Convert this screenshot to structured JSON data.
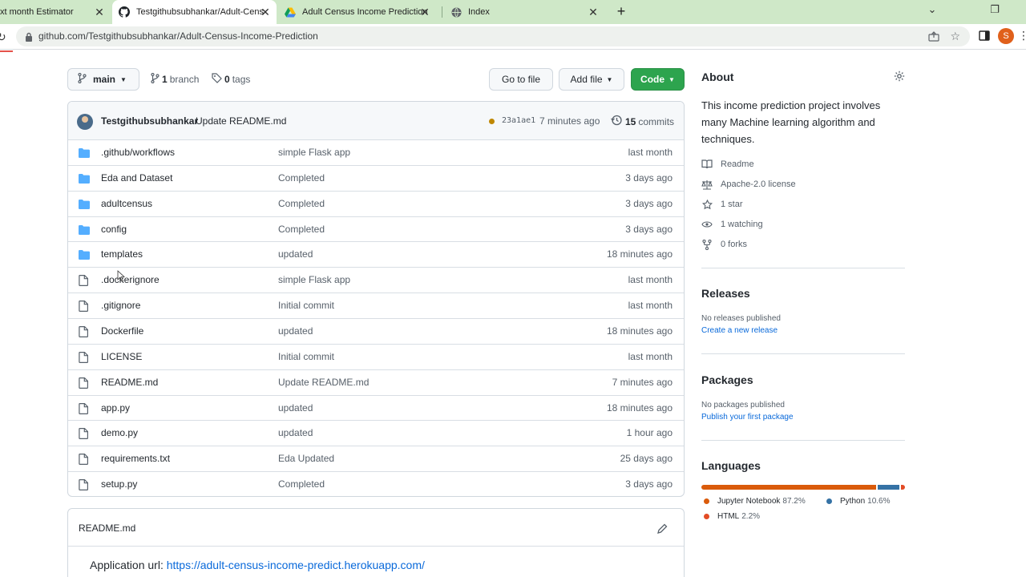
{
  "browser": {
    "tabs": [
      {
        "title": "xt month Estimator",
        "favicon": "none"
      },
      {
        "title": "Testgithubsubhankar/Adult-Cens",
        "favicon": "github-icon",
        "active": true
      },
      {
        "title": "Adult Census Income Prediction",
        "favicon": "google-drive-icon"
      },
      {
        "title": "Index",
        "favicon": "globe-icon"
      }
    ],
    "url": "github.com/Testgithubsubhankar/Adult-Census-Income-Prediction",
    "profile_initial": "S"
  },
  "repo": {
    "branch": "main",
    "branches_count": "1",
    "branches_label": "branch",
    "tags_count": "0",
    "tags_label": "tags",
    "go_to_file": "Go to file",
    "add_file": "Add file",
    "code": "Code"
  },
  "latest_commit": {
    "author": "Testgithubsubhankar",
    "message": "Update README.md",
    "sha": "23a1ae1",
    "time": "7 minutes ago",
    "commits_count": "15",
    "commits_label": "commits",
    "status_color": "#bf8700"
  },
  "files": [
    {
      "name": ".github/workflows",
      "type": "folder",
      "commit": "simple Flask app",
      "time": "last month"
    },
    {
      "name": "Eda and Dataset",
      "type": "folder",
      "commit": "Completed",
      "time": "3 days ago"
    },
    {
      "name": "adultcensus",
      "type": "folder",
      "commit": "Completed",
      "time": "3 days ago"
    },
    {
      "name": "config",
      "type": "folder",
      "commit": "Completed",
      "time": "3 days ago"
    },
    {
      "name": "templates",
      "type": "folder",
      "commit": "updated",
      "time": "18 minutes ago"
    },
    {
      "name": ".dockerignore",
      "type": "file",
      "commit": "simple Flask app",
      "time": "last month"
    },
    {
      "name": ".gitignore",
      "type": "file",
      "commit": "Initial commit",
      "time": "last month"
    },
    {
      "name": "Dockerfile",
      "type": "file",
      "commit": "updated",
      "time": "18 minutes ago"
    },
    {
      "name": "LICENSE",
      "type": "file",
      "commit": "Initial commit",
      "time": "last month"
    },
    {
      "name": "README.md",
      "type": "file",
      "commit": "Update README.md",
      "time": "7 minutes ago"
    },
    {
      "name": "app.py",
      "type": "file",
      "commit": "updated",
      "time": "18 minutes ago"
    },
    {
      "name": "demo.py",
      "type": "file",
      "commit": "updated",
      "time": "1 hour ago"
    },
    {
      "name": "requirements.txt",
      "type": "file",
      "commit": "Eda Updated",
      "time": "25 days ago"
    },
    {
      "name": "setup.py",
      "type": "file",
      "commit": "Completed",
      "time": "3 days ago"
    }
  ],
  "readme": {
    "title": "README.md",
    "app_label": "Application url:",
    "app_url": "https://adult-census-income-predict.herokuapp.com/"
  },
  "about": {
    "title": "About",
    "description": "This income prediction project involves many Machine learning algorithm and techniques.",
    "items": [
      {
        "icon": "book-icon",
        "label": "Readme"
      },
      {
        "icon": "scale-icon",
        "label": "Apache-2.0 license"
      },
      {
        "icon": "star-icon",
        "label": "1 star"
      },
      {
        "icon": "eye-icon",
        "label": "1 watching"
      },
      {
        "icon": "fork-icon",
        "label": "0 forks"
      }
    ]
  },
  "releases": {
    "title": "Releases",
    "empty": "No releases published",
    "link": "Create a new release"
  },
  "packages": {
    "title": "Packages",
    "empty": "No packages published",
    "link": "Publish your first package"
  },
  "languages": {
    "title": "Languages",
    "items": [
      {
        "name": "Jupyter Notebook",
        "percent": "87.2%",
        "value": 87.2,
        "color": "#da5b0b"
      },
      {
        "name": "Python",
        "percent": "10.6%",
        "value": 10.6,
        "color": "#3572a5"
      },
      {
        "name": "HTML",
        "percent": "2.2%",
        "value": 2.2,
        "color": "#e34c26"
      }
    ]
  },
  "colors": {
    "accent_green": "#2da44e",
    "link_blue": "#0969da",
    "folder_blue": "#54aeff"
  }
}
